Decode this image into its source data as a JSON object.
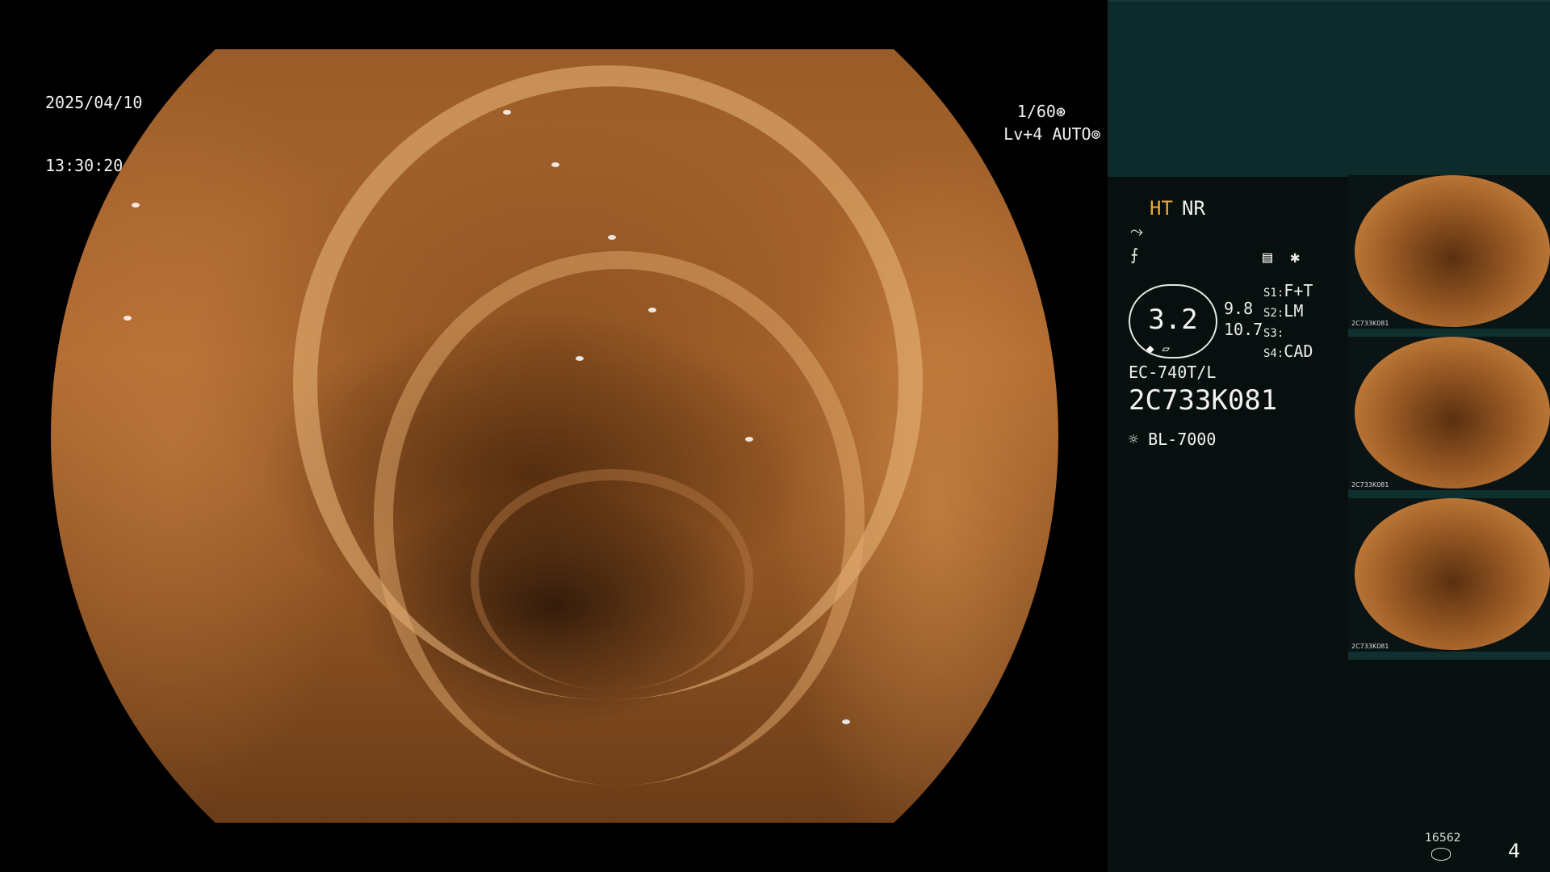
{
  "overlay": {
    "date": "2025/04/10",
    "time": "13:30:20",
    "shutter": "1/60",
    "shutter_icon": "aperture-icon",
    "level": "Lv+4 AUTO",
    "level_icon": "iris-icon"
  },
  "panel": {
    "mode_ht": "HT",
    "mode_nr": "NR",
    "icons": [
      "tone-curve-icon",
      "enhance-icon",
      "menu-grid-icon",
      "asterisk-icon",
      "zoom-marker-icon",
      "light-source-icon",
      "storage-icon"
    ],
    "gauge_value": "3.2",
    "gauge_sub_1": "9.8",
    "gauge_sub_2": "10.7",
    "settings": [
      {
        "key": "S1:",
        "value": "F+T"
      },
      {
        "key": "S2:",
        "value": "LM"
      },
      {
        "key": "S3:",
        "value": ""
      },
      {
        "key": "S4:",
        "value": "CAD"
      }
    ],
    "scope_model": "EC-740T/L",
    "serial": "2C733K081",
    "light_source": "BL-7000",
    "thumbnails": [
      {
        "caption": "2C733K081"
      },
      {
        "caption": "2C733K081"
      },
      {
        "caption": "2C733K081"
      }
    ],
    "image_count": "16562",
    "page_number": "4"
  },
  "colors": {
    "accent_ht": "#f0a43a",
    "panel_top": "#0e2b2b",
    "panel_bg": "#07100f"
  }
}
